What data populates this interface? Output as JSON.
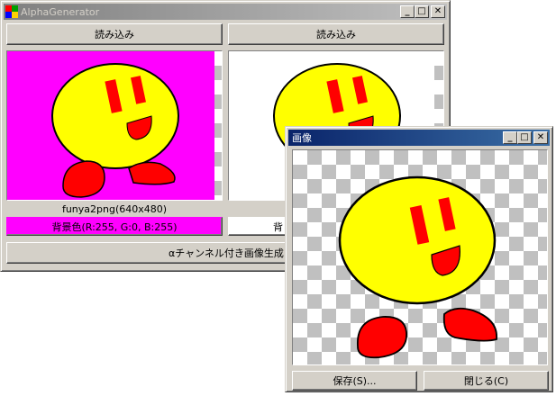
{
  "main_window": {
    "title": "AlphaGenerator",
    "load_left_label": "読み込み",
    "load_right_label": "読み込み",
    "image_info": "funya2png(640x480)",
    "bg_color_left_label": "背景色(R:255, G:0, B:255)",
    "bg_color_right_label": "背",
    "generate_label": "αチャンネル付き画像生成",
    "bg_color_left_swatch": "#ff00ff"
  },
  "image_window": {
    "title": "画像",
    "save_label": "保存(S)...",
    "close_label": "閉じる(C)"
  },
  "titlebar_buttons": {
    "minimize": "_",
    "maximize": "□",
    "close": "✕"
  },
  "colors": {
    "face": "#ffff00",
    "features": "#ff0000",
    "checker": "#c0c0c0"
  }
}
